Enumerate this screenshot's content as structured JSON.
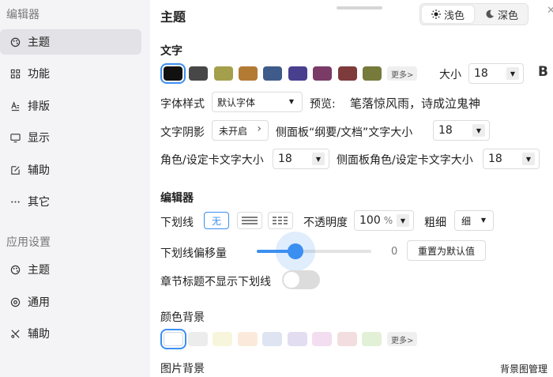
{
  "sidebar": {
    "editor_section": "编辑器",
    "editor_items": [
      {
        "label": "主题",
        "icon": "palette-icon",
        "active": true
      },
      {
        "label": "功能",
        "icon": "grid-icon"
      },
      {
        "label": "排版",
        "icon": "text-format-icon"
      },
      {
        "label": "显示",
        "icon": "monitor-icon"
      },
      {
        "label": "辅助",
        "icon": "edit-icon"
      },
      {
        "label": "其它",
        "icon": "ellipsis-icon"
      }
    ],
    "app_section": "应用设置",
    "app_items": [
      {
        "label": "主题",
        "icon": "palette-icon"
      },
      {
        "label": "通用",
        "icon": "target-icon"
      },
      {
        "label": "辅助",
        "icon": "tools-icon"
      }
    ]
  },
  "header": {
    "title": "主题",
    "theme_light": "浅色",
    "theme_dark": "深色"
  },
  "text_section": {
    "title": "文字",
    "colors": [
      "#111111",
      "#474747",
      "#a49f4b",
      "#b37a34",
      "#3f5b8a",
      "#483f8e",
      "#7a3b66",
      "#7d3b3b",
      "#767a3b"
    ],
    "more_label": "更多>",
    "size_label": "大小",
    "size_value": "18",
    "bold_label": "B",
    "font_style_label": "字体样式",
    "font_style_value": "默认字体",
    "preview_label": "预览:",
    "preview_text": "笔落惊风雨，诗成泣鬼神",
    "shadow_label": "文字阴影",
    "shadow_value": "未开启",
    "side_size_label": "侧面板“纲要/文档”文字大小",
    "side_size_value": "18",
    "role_size_label": "角色/设定卡文字大小",
    "role_size_value": "18",
    "side_role_label": "侧面板角色/设定卡文字大小",
    "side_role_value": "18"
  },
  "editor_section": {
    "title": "编辑器",
    "underline_label": "下划线",
    "underline_none": "无",
    "opacity_label": "不透明度",
    "opacity_value": "100",
    "opacity_unit": "%",
    "thickness_label": "粗细",
    "thickness_value": "细",
    "offset_label": "下划线偏移量",
    "offset_value": "0",
    "offset_fraction": 0.34,
    "reset_label": "重置为默认值",
    "chapter_label": "章节标题不显示下划线",
    "chapter_toggle_on": false
  },
  "bg_section": {
    "color_bg_label": "颜色背景",
    "colors": [
      "#ffffff",
      "#ececec",
      "#f7f5dc",
      "#fbeadb",
      "#dfe4f2",
      "#e3ddf2",
      "#f2def0",
      "#f2dede",
      "#e3f0d8"
    ],
    "more_label": "更多>",
    "image_bg_label": "图片背景",
    "image_manage": "背景图管理"
  }
}
